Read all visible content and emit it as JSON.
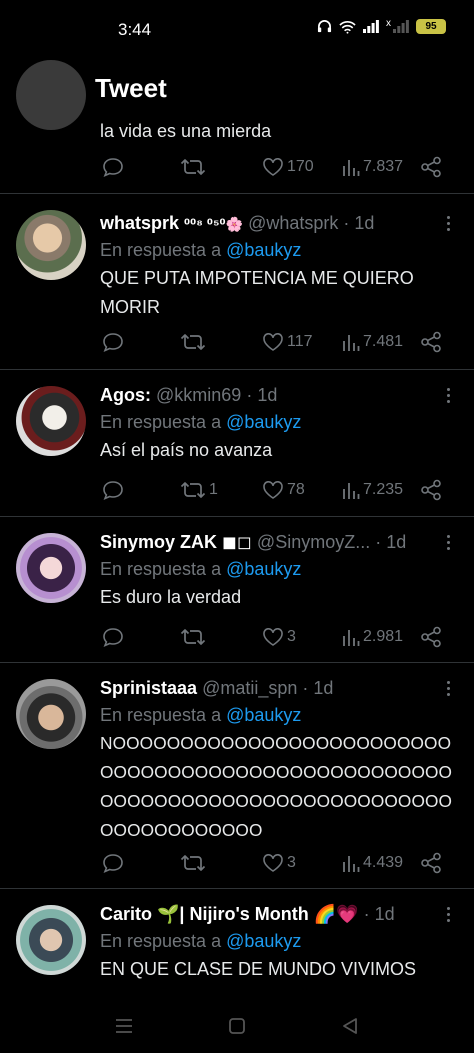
{
  "status_bar": {
    "time": "3:44",
    "battery": "95",
    "sim": "x"
  },
  "header": {
    "title": "Tweet"
  },
  "tweets": [
    {
      "text": "la vida es una mierda",
      "stats": {
        "replies": "",
        "retweets": "",
        "likes": "170",
        "views": "7.837"
      }
    },
    {
      "name": "whatsprk",
      "name_suffix": "⁰⁰⁸ ⁰⁵⁰🌸",
      "handle": "@whatsprk",
      "time": "1d",
      "reply_prefix": "En respuesta a",
      "reply_mention": "@baukyz",
      "text": "QUE PUTA IMPOTENCIA ME QUIERO MORIR",
      "stats": {
        "replies": "",
        "retweets": "",
        "likes": "117",
        "views": "7.481"
      }
    },
    {
      "name": "Agos:",
      "handle": "@kkmin69",
      "time": "1d",
      "reply_prefix": "En respuesta a",
      "reply_mention": "@baukyz",
      "text": "Así el país no avanza",
      "stats": {
        "replies": "",
        "retweets": "1",
        "likes": "78",
        "views": "7.235"
      }
    },
    {
      "name": "Sinymoy ZAK ◼◻",
      "handle": "@SinymoyZ...",
      "time": "1d",
      "reply_prefix": "En respuesta a",
      "reply_mention": "@baukyz",
      "text": "Es duro la verdad",
      "stats": {
        "replies": "",
        "retweets": "",
        "likes": "3",
        "views": "2.981"
      }
    },
    {
      "name": "Sprinistaaa",
      "handle": "@matii_spn",
      "time": "1d",
      "reply_prefix": "En respuesta a",
      "reply_mention": "@baukyz",
      "text": "NOOOOOOOOOOOOOOOOOOOOOOOOOOOOOOOOOOOOOOOOOOOOOOOOOOOOOOOOOOOOOOOOOOOOOOOOOOOOOOOOOOOOOOOOO",
      "stats": {
        "replies": "",
        "retweets": "",
        "likes": "3",
        "views": "4.439"
      }
    },
    {
      "name": "Carito 🌱| Nijiro's Month 🌈💗",
      "handle": "",
      "time": "1d",
      "reply_prefix": "En respuesta a",
      "reply_mention": "@baukyz",
      "text": "EN QUE CLASE DE MUNDO VIVIMOS"
    }
  ],
  "colors": {
    "background": "#000000",
    "muted": "#71767b",
    "link": "#1d9bf0",
    "divider": "#2f3336"
  },
  "icons": [
    "back-arrow-icon",
    "reply-icon",
    "retweet-icon",
    "heart-icon",
    "views-icon",
    "share-icon",
    "more-icon"
  ]
}
